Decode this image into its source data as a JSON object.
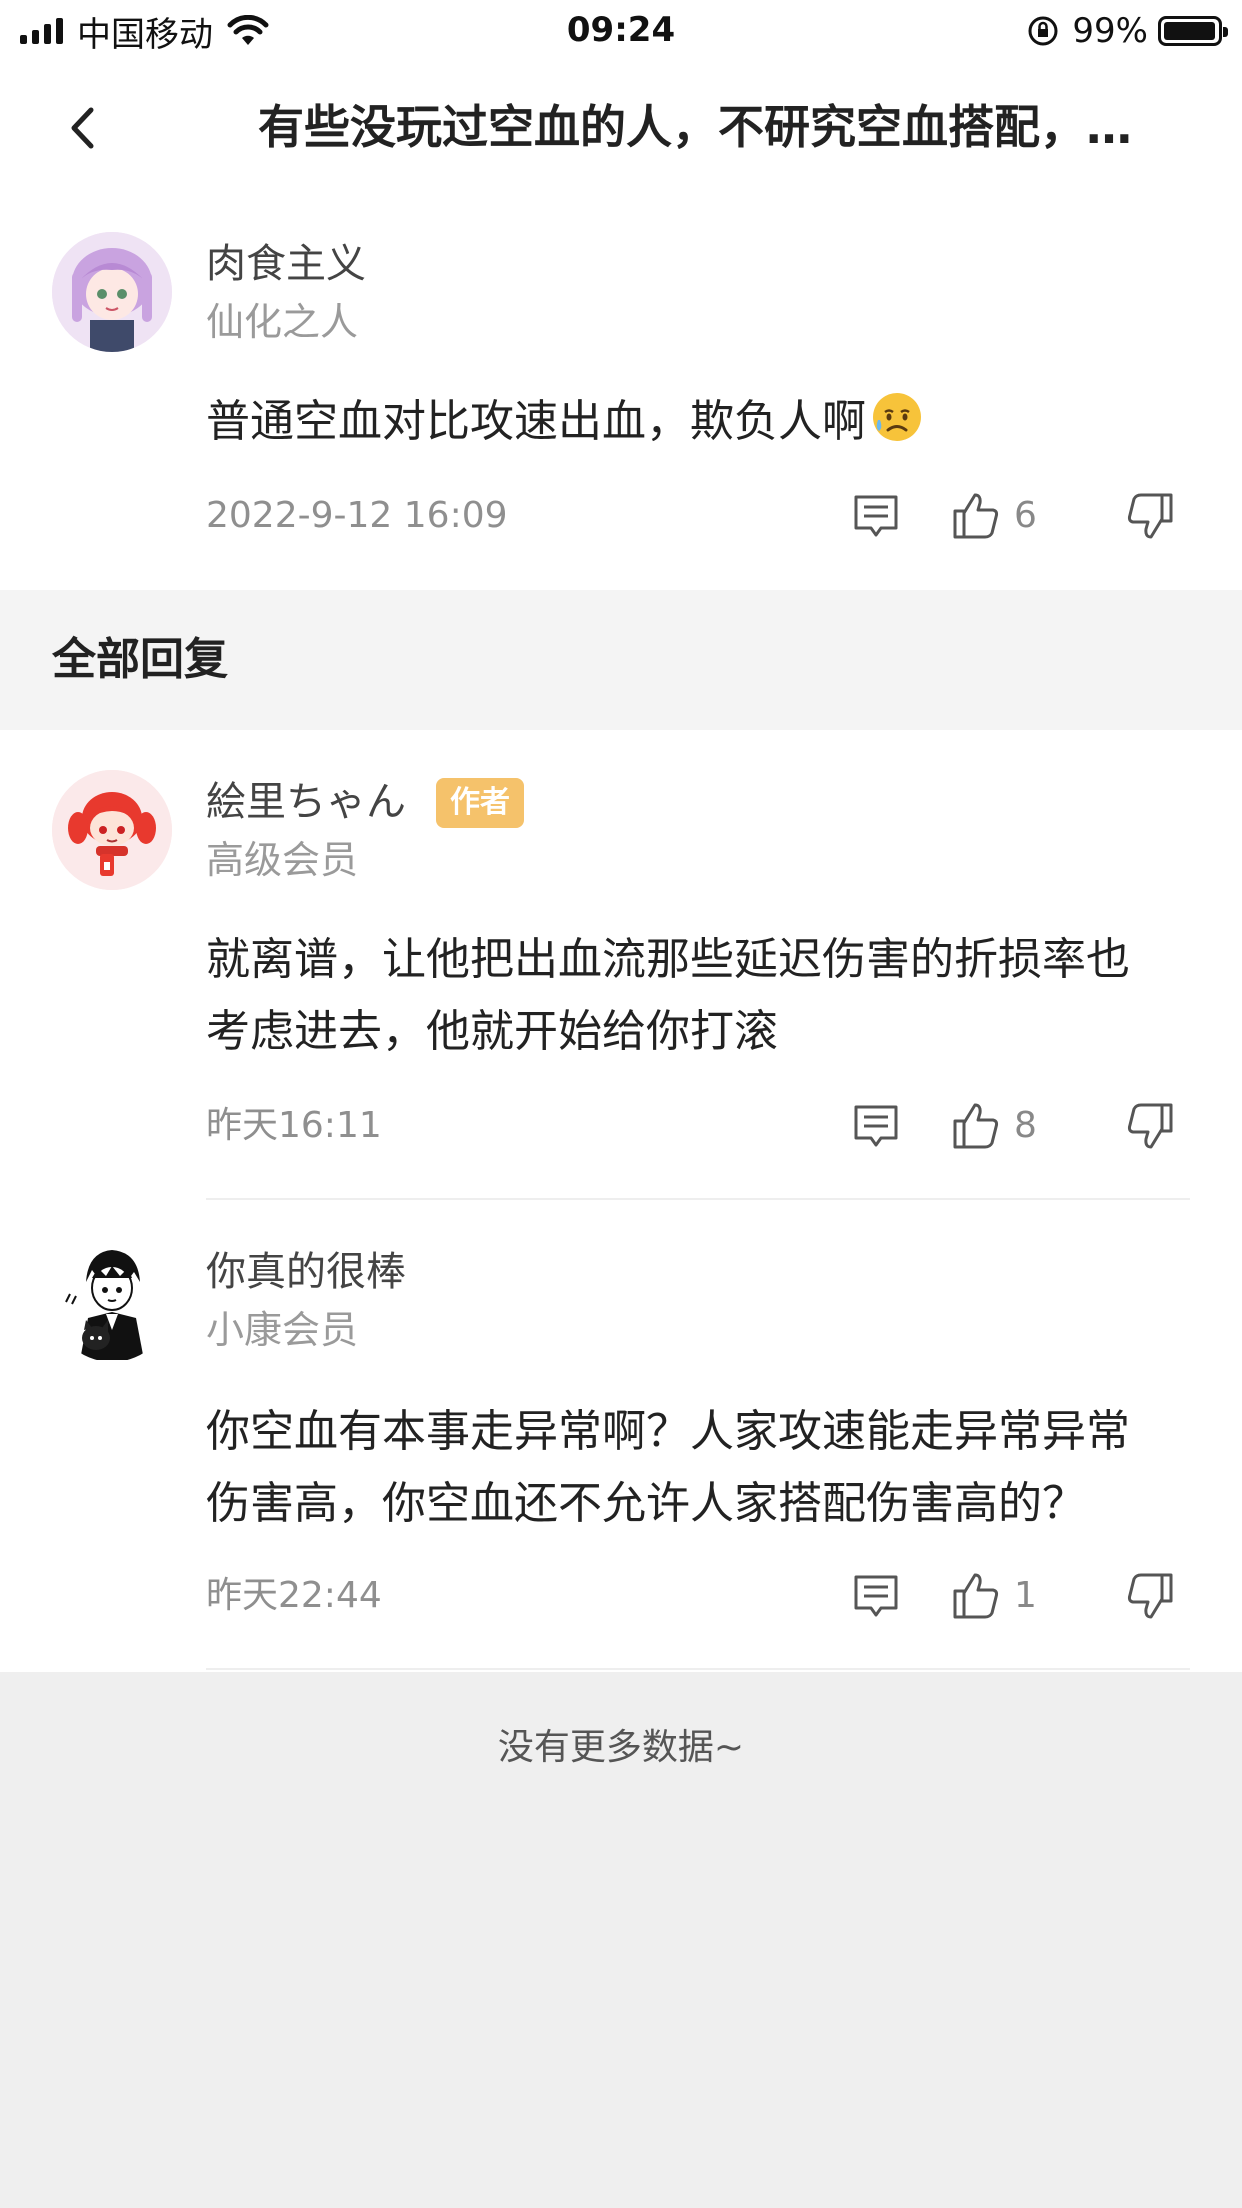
{
  "status_bar": {
    "carrier": "中国移动",
    "time": "09:24",
    "battery": "99%"
  },
  "nav": {
    "title": "有些没玩过空血的人，不研究空血搭配，…"
  },
  "original_post": {
    "username": "肉食主义",
    "level": "仙化之人",
    "text": "普通空血对比攻速出血，欺负人啊",
    "emoji": "sad-sweat-face",
    "date": "2022-9-12 16:09",
    "likes": "6"
  },
  "replies_section": {
    "label": "全部回复"
  },
  "replies": [
    {
      "username": "絵里ちゃん",
      "badge": "作者",
      "level": "高级会员",
      "text_line1": "就离谱，让他把出血流那些延迟伤害的折损率也",
      "text_line2": "考虑进去，他就开始给你打滚",
      "date": "昨天16:11",
      "likes": "8"
    },
    {
      "username": "你真的很棒",
      "level": "小康会员",
      "text_line1": "你空血有本事走异常啊？人家攻速能走异常异常",
      "text_line2": "伤害高，你空血还不允许人家搭配伤害高的？",
      "date": "昨天22:44",
      "likes": "1"
    }
  ],
  "footer": {
    "no_more": "没有更多数据~"
  },
  "colors": {
    "background": "#efefef",
    "badge": "#f5c26b",
    "meta_text": "#8f8f8f"
  }
}
